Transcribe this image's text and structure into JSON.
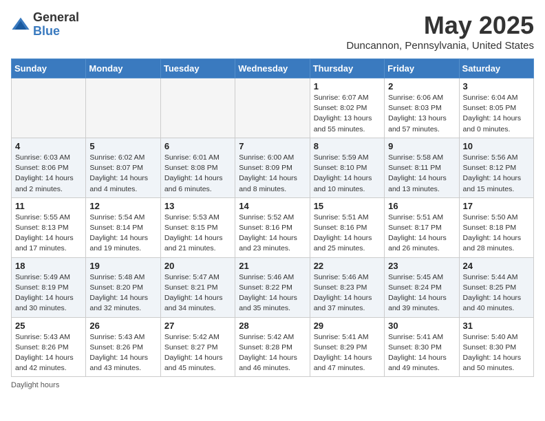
{
  "header": {
    "logo_general": "General",
    "logo_blue": "Blue",
    "title": "May 2025",
    "subtitle": "Duncannon, Pennsylvania, United States"
  },
  "weekdays": [
    "Sunday",
    "Monday",
    "Tuesday",
    "Wednesday",
    "Thursday",
    "Friday",
    "Saturday"
  ],
  "footer": "Daylight hours",
  "weeks": [
    [
      {
        "day": "",
        "info": ""
      },
      {
        "day": "",
        "info": ""
      },
      {
        "day": "",
        "info": ""
      },
      {
        "day": "",
        "info": ""
      },
      {
        "day": "1",
        "info": "Sunrise: 6:07 AM\nSunset: 8:02 PM\nDaylight: 13 hours\nand 55 minutes."
      },
      {
        "day": "2",
        "info": "Sunrise: 6:06 AM\nSunset: 8:03 PM\nDaylight: 13 hours\nand 57 minutes."
      },
      {
        "day": "3",
        "info": "Sunrise: 6:04 AM\nSunset: 8:05 PM\nDaylight: 14 hours\nand 0 minutes."
      }
    ],
    [
      {
        "day": "4",
        "info": "Sunrise: 6:03 AM\nSunset: 8:06 PM\nDaylight: 14 hours\nand 2 minutes."
      },
      {
        "day": "5",
        "info": "Sunrise: 6:02 AM\nSunset: 8:07 PM\nDaylight: 14 hours\nand 4 minutes."
      },
      {
        "day": "6",
        "info": "Sunrise: 6:01 AM\nSunset: 8:08 PM\nDaylight: 14 hours\nand 6 minutes."
      },
      {
        "day": "7",
        "info": "Sunrise: 6:00 AM\nSunset: 8:09 PM\nDaylight: 14 hours\nand 8 minutes."
      },
      {
        "day": "8",
        "info": "Sunrise: 5:59 AM\nSunset: 8:10 PM\nDaylight: 14 hours\nand 10 minutes."
      },
      {
        "day": "9",
        "info": "Sunrise: 5:58 AM\nSunset: 8:11 PM\nDaylight: 14 hours\nand 13 minutes."
      },
      {
        "day": "10",
        "info": "Sunrise: 5:56 AM\nSunset: 8:12 PM\nDaylight: 14 hours\nand 15 minutes."
      }
    ],
    [
      {
        "day": "11",
        "info": "Sunrise: 5:55 AM\nSunset: 8:13 PM\nDaylight: 14 hours\nand 17 minutes."
      },
      {
        "day": "12",
        "info": "Sunrise: 5:54 AM\nSunset: 8:14 PM\nDaylight: 14 hours\nand 19 minutes."
      },
      {
        "day": "13",
        "info": "Sunrise: 5:53 AM\nSunset: 8:15 PM\nDaylight: 14 hours\nand 21 minutes."
      },
      {
        "day": "14",
        "info": "Sunrise: 5:52 AM\nSunset: 8:16 PM\nDaylight: 14 hours\nand 23 minutes."
      },
      {
        "day": "15",
        "info": "Sunrise: 5:51 AM\nSunset: 8:16 PM\nDaylight: 14 hours\nand 25 minutes."
      },
      {
        "day": "16",
        "info": "Sunrise: 5:51 AM\nSunset: 8:17 PM\nDaylight: 14 hours\nand 26 minutes."
      },
      {
        "day": "17",
        "info": "Sunrise: 5:50 AM\nSunset: 8:18 PM\nDaylight: 14 hours\nand 28 minutes."
      }
    ],
    [
      {
        "day": "18",
        "info": "Sunrise: 5:49 AM\nSunset: 8:19 PM\nDaylight: 14 hours\nand 30 minutes."
      },
      {
        "day": "19",
        "info": "Sunrise: 5:48 AM\nSunset: 8:20 PM\nDaylight: 14 hours\nand 32 minutes."
      },
      {
        "day": "20",
        "info": "Sunrise: 5:47 AM\nSunset: 8:21 PM\nDaylight: 14 hours\nand 34 minutes."
      },
      {
        "day": "21",
        "info": "Sunrise: 5:46 AM\nSunset: 8:22 PM\nDaylight: 14 hours\nand 35 minutes."
      },
      {
        "day": "22",
        "info": "Sunrise: 5:46 AM\nSunset: 8:23 PM\nDaylight: 14 hours\nand 37 minutes."
      },
      {
        "day": "23",
        "info": "Sunrise: 5:45 AM\nSunset: 8:24 PM\nDaylight: 14 hours\nand 39 minutes."
      },
      {
        "day": "24",
        "info": "Sunrise: 5:44 AM\nSunset: 8:25 PM\nDaylight: 14 hours\nand 40 minutes."
      }
    ],
    [
      {
        "day": "25",
        "info": "Sunrise: 5:43 AM\nSunset: 8:26 PM\nDaylight: 14 hours\nand 42 minutes."
      },
      {
        "day": "26",
        "info": "Sunrise: 5:43 AM\nSunset: 8:26 PM\nDaylight: 14 hours\nand 43 minutes."
      },
      {
        "day": "27",
        "info": "Sunrise: 5:42 AM\nSunset: 8:27 PM\nDaylight: 14 hours\nand 45 minutes."
      },
      {
        "day": "28",
        "info": "Sunrise: 5:42 AM\nSunset: 8:28 PM\nDaylight: 14 hours\nand 46 minutes."
      },
      {
        "day": "29",
        "info": "Sunrise: 5:41 AM\nSunset: 8:29 PM\nDaylight: 14 hours\nand 47 minutes."
      },
      {
        "day": "30",
        "info": "Sunrise: 5:41 AM\nSunset: 8:30 PM\nDaylight: 14 hours\nand 49 minutes."
      },
      {
        "day": "31",
        "info": "Sunrise: 5:40 AM\nSunset: 8:30 PM\nDaylight: 14 hours\nand 50 minutes."
      }
    ]
  ]
}
